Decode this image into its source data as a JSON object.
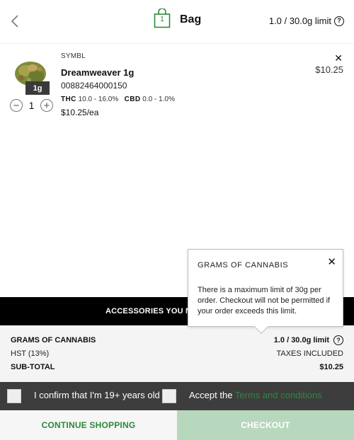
{
  "header": {
    "title": "Bag",
    "bag_count": "1",
    "limit_text": "1.0 / 30.0g limit",
    "help_symbol": "?"
  },
  "cart_item": {
    "brand": "SYMBL",
    "name": "Dreamweaver 1g",
    "sku": "00882464000150",
    "size_badge": "1g",
    "thc_label": "THC",
    "thc_range": "10.0 - 16.0%",
    "cbd_label": "CBD",
    "cbd_range": "0.0 - 1.0%",
    "unit_price": "$10.25/ea",
    "line_total": "$10.25",
    "quantity": "1",
    "remove_symbol": "✕",
    "decrement_symbol": "−",
    "increment_symbol": "+"
  },
  "banner": {
    "text": "ACCESSORIES YOU MIGHT LIKE"
  },
  "summary": {
    "grams_label": "GRAMS OF CANNABIS",
    "grams_value": "1.0 / 30.0g limit",
    "hst_label": "HST (13%)",
    "hst_value": "TAXES INCLUDED",
    "subtotal_label": "SUB-TOTAL",
    "subtotal_value": "$10.25"
  },
  "confirm": {
    "age_text": "I confirm that I'm 19+ years old",
    "accept_text": "Accept the",
    "terms_link": "Terms and conditions"
  },
  "buttons": {
    "continue_label": "CONTINUE SHOPPING",
    "checkout_label": "CHECKOUT"
  },
  "popover": {
    "title": "GRAMS OF CANNABIS",
    "close_symbol": "✕",
    "body": "There is a maximum limit of 30g per order. Checkout will not be permitted if your order exceeds this limit."
  },
  "colors": {
    "accent_green": "#2a8a3a",
    "checkout_disabled": "#b8d8bd",
    "confirm_bar": "#3d3d3d",
    "banner": "#000000"
  },
  "icons": {
    "back": "chevron-left-icon",
    "bag": "shopping-bag-icon",
    "help": "help-circle-icon",
    "close": "close-icon",
    "minus": "minus-circle-icon",
    "plus": "plus-circle-icon"
  }
}
